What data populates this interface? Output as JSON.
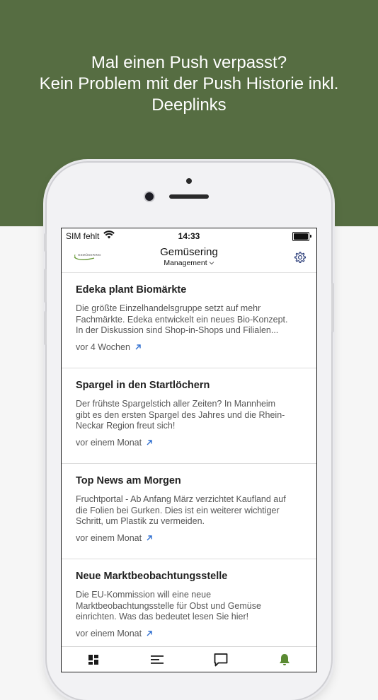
{
  "promo": {
    "headline_lines": [
      "Mal einen Push verpasst?",
      "Kein Problem mit der Push Historie inkl.",
      "Deeplinks"
    ]
  },
  "status_bar": {
    "carrier": "SIM fehlt",
    "time": "14:33"
  },
  "header": {
    "logo_text": "GEMÜSERING",
    "title": "Gemüsering",
    "subtitle": "Management",
    "settings_icon": "gear-icon"
  },
  "colors": {
    "brand_green": "#566d42",
    "link_blue": "#2f6fd0",
    "active_tab": "#5a8a32"
  },
  "notifications": [
    {
      "title": "Edeka plant Biomärkte",
      "body": "Die größte Einzelhandelsgruppe setzt auf mehr\nFachmärkte. Edeka entwickelt ein neues Bio-Konzept.\nIn der Diskussion sind Shop-in-Shops und Filialen...",
      "time": "vor 4 Wochen"
    },
    {
      "title": "Spargel in den Startlöchern",
      "body": "Der frühste Spargelstich aller Zeiten? In Mannheim\ngibt es den ersten Spargel des Jahres und die Rhein-\nNeckar Region freut sich!",
      "time": "vor einem Monat"
    },
    {
      "title": "Top News am Morgen",
      "body": "Fruchtportal - Ab Anfang März verzichtet Kaufland auf\ndie Folien bei Gurken. Dies ist ein weiterer wichtiger\nSchritt, um Plastik zu vermeiden.",
      "time": "vor einem Monat"
    },
    {
      "title": "Neue Marktbeobachtungsstelle",
      "body": "Die EU-Kommission will eine neue\nMarktbeobachtungsstelle für Obst und Gemüse\neinrichten. Was das bedeutet lesen Sie hier!",
      "time": "vor einem Monat"
    }
  ],
  "tab_bar": {
    "tabs": [
      {
        "icon": "dashboard-icon",
        "active": false
      },
      {
        "icon": "list-icon",
        "active": false
      },
      {
        "icon": "chat-icon",
        "active": false
      },
      {
        "icon": "bell-icon",
        "active": true
      }
    ]
  }
}
